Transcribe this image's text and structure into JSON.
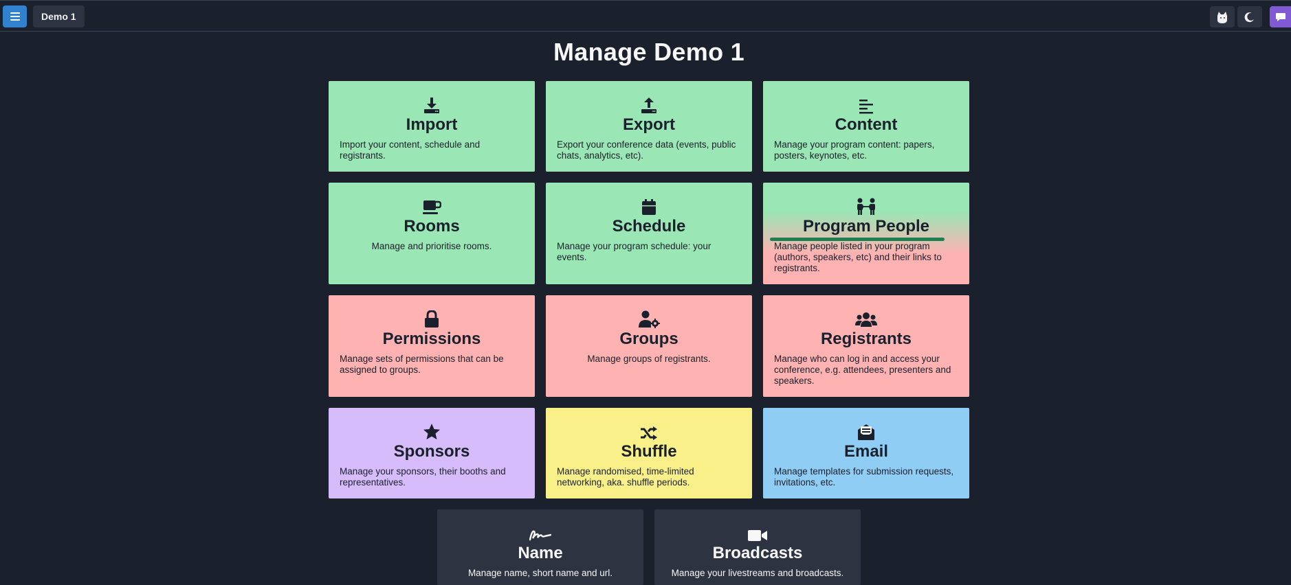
{
  "topbar": {
    "conference_name": "Demo 1"
  },
  "page": {
    "title": "Manage Demo 1"
  },
  "cards": {
    "import": {
      "title": "Import",
      "desc": "Import your content, schedule and registrants."
    },
    "export": {
      "title": "Export",
      "desc": "Export your conference data (events, public chats, analytics, etc)."
    },
    "content": {
      "title": "Content",
      "desc": "Manage your program content: papers, posters, keynotes, etc."
    },
    "rooms": {
      "title": "Rooms",
      "desc": "Manage and prioritise rooms."
    },
    "schedule": {
      "title": "Schedule",
      "desc": "Manage your program schedule: your events."
    },
    "program_people": {
      "title": "Program People",
      "desc": "Manage people listed in your program (authors, speakers, etc) and their links to registrants."
    },
    "permissions": {
      "title": "Permissions",
      "desc": "Manage sets of permissions that can be assigned to groups."
    },
    "groups": {
      "title": "Groups",
      "desc": "Manage groups of registrants."
    },
    "registrants": {
      "title": "Registrants",
      "desc": "Manage who can log in and access your conference, e.g. attendees, presenters and speakers."
    },
    "sponsors": {
      "title": "Sponsors",
      "desc": "Manage your sponsors, their booths and representatives."
    },
    "shuffle": {
      "title": "Shuffle",
      "desc": "Manage randomised, time-limited networking, aka. shuffle periods."
    },
    "email": {
      "title": "Email",
      "desc": "Manage templates for submission requests, invitations, etc."
    },
    "name": {
      "title": "Name",
      "desc": "Manage name, short name and url."
    },
    "broadcasts": {
      "title": "Broadcasts",
      "desc": "Manage your livestreams and broadcasts."
    }
  },
  "colors": {
    "background": "#1a202c",
    "green": "#9ae6b4",
    "red": "#feb2b2",
    "purple": "#d6bcfa",
    "yellow": "#faf089",
    "blue": "#90cdf4",
    "dark_card": "#2d3340",
    "menu_button": "#3182ce",
    "chat_button": "#805ad5",
    "underline": "#1c7f50"
  },
  "icons": {
    "menu": "hamburger-icon",
    "avatar": "cat-icon",
    "theme": "moon-icon",
    "chat": "chat-bubble-icon"
  }
}
